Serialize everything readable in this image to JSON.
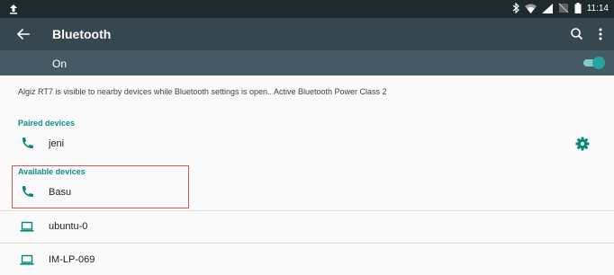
{
  "status_bar": {
    "time": "11:14",
    "icons": [
      "upload-icon",
      "bluetooth-icon",
      "wifi-icon",
      "signal-icon",
      "no-sim-icon",
      "battery-icon"
    ]
  },
  "toolbar": {
    "title": "Bluetooth",
    "icons": [
      "back-arrow-icon",
      "search-icon",
      "more-vert-icon"
    ]
  },
  "master_switch": {
    "label": "On",
    "enabled": true
  },
  "visibility_notice": "Algiz RT7 is visible to nearby devices while Bluetooth settings is open.. Active Bluetooth Power Class 2",
  "paired": {
    "header": "Paired devices",
    "devices": [
      {
        "name": "jeni",
        "icon": "phone-icon",
        "has_settings": true
      }
    ]
  },
  "available": {
    "header": "Available devices",
    "devices": [
      {
        "name": "Basu",
        "icon": "phone-icon"
      },
      {
        "name": "ubuntu-0",
        "icon": "laptop-icon"
      },
      {
        "name": "IM-LP-069",
        "icon": "laptop-icon"
      }
    ]
  },
  "colors": {
    "status_bar": "#1f2a2e",
    "toolbar": "#37474f",
    "switch_bar": "#455a64",
    "accent": "#0a8f8a",
    "highlight_border": "#d9534f"
  }
}
